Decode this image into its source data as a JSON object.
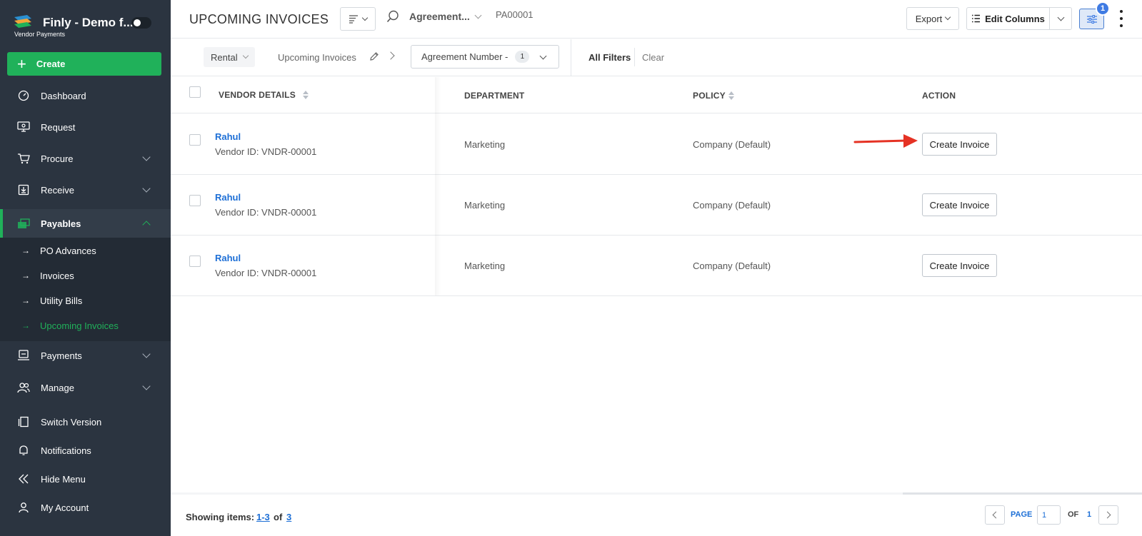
{
  "brand": {
    "title": "Finly - Demo f...",
    "subtitle": "Vendor Payments"
  },
  "sidebar": {
    "create_label": "Create",
    "items": [
      {
        "label": "Dashboard",
        "icon": "gauge-icon"
      },
      {
        "label": "Request",
        "icon": "request-icon"
      },
      {
        "label": "Procure",
        "icon": "cart-icon"
      },
      {
        "label": "Receive",
        "icon": "receive-icon"
      },
      {
        "label": "Payables",
        "icon": "payables-icon"
      },
      {
        "label": "Payments",
        "icon": "payments-icon"
      },
      {
        "label": "Manage",
        "icon": "users-icon"
      },
      {
        "label": "Switch Version",
        "icon": "switch-icon"
      },
      {
        "label": "Notifications",
        "icon": "bell-icon"
      },
      {
        "label": "Hide Menu",
        "icon": "double-chevron-left-icon"
      },
      {
        "label": "My Account",
        "icon": "user-icon"
      }
    ],
    "payables_sub": [
      {
        "label": "PO Advances"
      },
      {
        "label": "Invoices"
      },
      {
        "label": "Utility Bills"
      },
      {
        "label": "Upcoming Invoices"
      }
    ],
    "arrow": "→"
  },
  "header": {
    "title": "UPCOMING INVOICES",
    "search_field": "Agreement...",
    "search_value": "PA00001",
    "export_label": "Export",
    "edit_columns_label": "Edit Columns",
    "filter_count": "1"
  },
  "filterbar": {
    "rental": "Rental",
    "upcoming": "Upcoming Invoices",
    "agreement_chip": "Agreement Number  -",
    "agreement_count": "1",
    "all_filters": "All Filters",
    "clear": "Clear"
  },
  "table": {
    "columns": [
      "VENDOR DETAILS",
      "DEPARTMENT",
      "POLICY",
      "ACTION"
    ],
    "rows": [
      {
        "vendor": "Rahul",
        "vendor_id": "Vendor ID: VNDR-00001",
        "department": "Marketing",
        "policy": "Company (Default)",
        "action": "Create Invoice"
      },
      {
        "vendor": "Rahul",
        "vendor_id": "Vendor ID: VNDR-00001",
        "department": "Marketing",
        "policy": "Company (Default)",
        "action": "Create Invoice"
      },
      {
        "vendor": "Rahul",
        "vendor_id": "Vendor ID: VNDR-00001",
        "department": "Marketing",
        "policy": "Company (Default)",
        "action": "Create Invoice"
      }
    ]
  },
  "footer": {
    "showing_label": "Showing items:",
    "range": "1-3",
    "of": "of",
    "total": "3",
    "page_label": "PAGE",
    "page_value": "1",
    "page_of": "OF",
    "page_total": "1"
  },
  "colors": {
    "sidebar_bg": "#2b3440",
    "accent_green": "#20b15a",
    "link_blue": "#1d6fd6",
    "annotation_red": "#e53224"
  }
}
